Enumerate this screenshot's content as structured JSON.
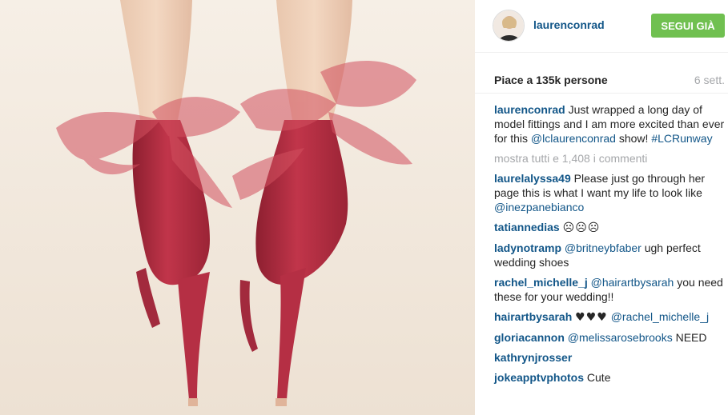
{
  "photo": {
    "alt_icon": "red-heels-photo",
    "colors": {
      "background": "#f5ede3",
      "shoe": "#c1354a",
      "ribbon": "#d2505f"
    }
  },
  "header": {
    "username": "laurenconrad",
    "follow_label": "SEGUI GIÀ",
    "follow_color": "#70c050"
  },
  "likes": {
    "label": "Piace a 135k persone",
    "time": "6 sett."
  },
  "caption": {
    "username": "laurenconrad",
    "text": "Just wrapped a long day of model fittings and I am more excited than ever for this",
    "mention": "@lclaurenconrad",
    "after": "show!",
    "hashtag": "#LCRunway"
  },
  "view_all": "mostra tutti e 1,408 i commenti",
  "comments": [
    {
      "username": "laurelalyssa49",
      "text": "Please just go through her page this is what I want my life to look like",
      "mention": "@inezpanebianco",
      "after": ""
    },
    {
      "username": "tatiannedias",
      "text": "",
      "mention": "",
      "after": "",
      "emoji": "☹☹☹"
    },
    {
      "username": "ladynotramp",
      "text": "",
      "mention": "@britneybfaber",
      "after": "ugh perfect wedding shoes"
    },
    {
      "username": "rachel_michelle_j",
      "text": "",
      "mention": "@hairartbysarah",
      "after": "you need these for your wedding!!"
    },
    {
      "username": "hairartbysarah",
      "text": "",
      "emoji": "♥♥♥",
      "mention": "@rachel_michelle_j",
      "after": ""
    },
    {
      "username": "gloriacannon",
      "text": "",
      "mention": "@melissarosebrooks",
      "after": "NEED"
    },
    {
      "username": "kathrynjrosser",
      "text": "",
      "mention": "",
      "after": ""
    },
    {
      "username": "jokeapptvphotos",
      "text": "Cute",
      "mention": "",
      "after": ""
    }
  ]
}
